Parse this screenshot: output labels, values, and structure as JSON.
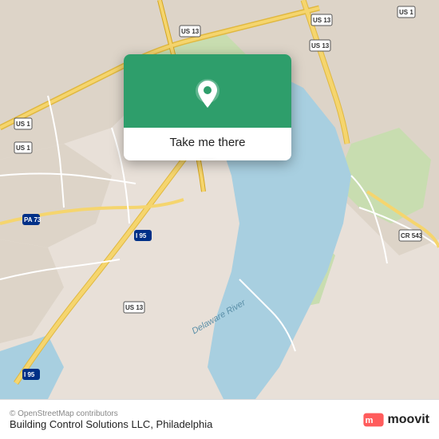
{
  "map": {
    "alt": "Map of Philadelphia area showing Delaware River"
  },
  "popup": {
    "take_me_there": "Take me there"
  },
  "bottom_bar": {
    "copyright": "© OpenStreetMap contributors",
    "business_name": "Building Control Solutions LLC, Philadelphia",
    "moovit": "moovit"
  }
}
